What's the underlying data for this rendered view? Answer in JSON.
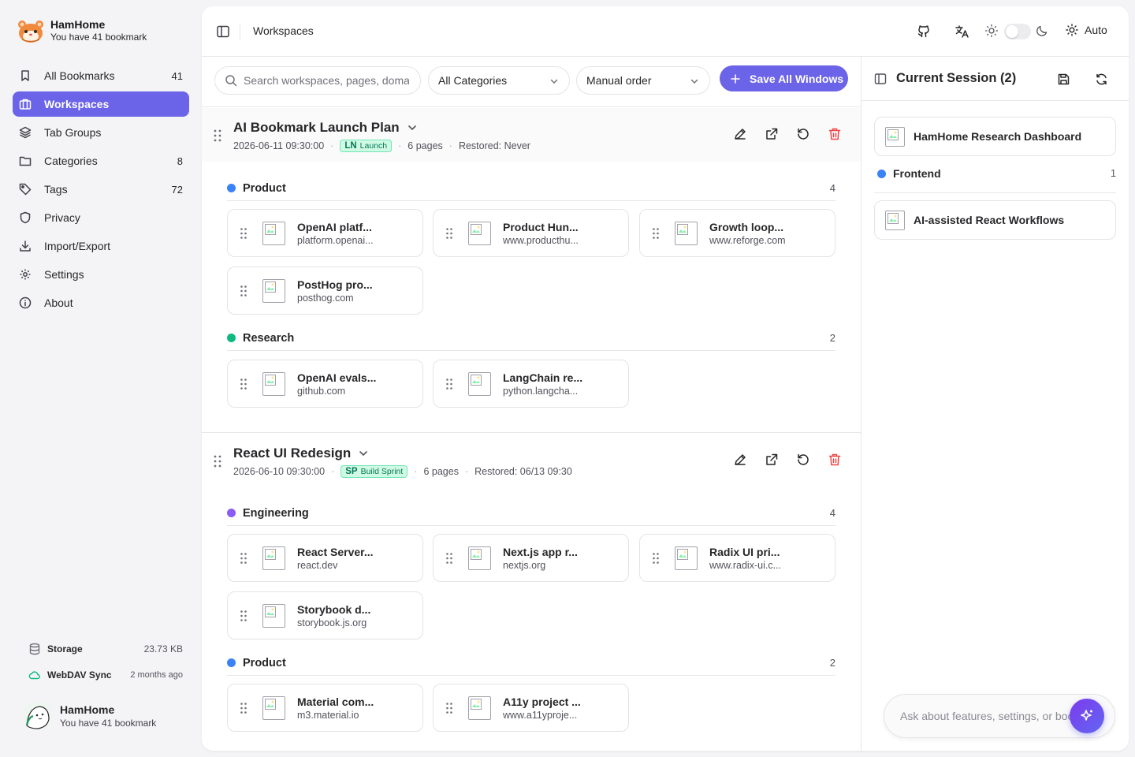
{
  "app": {
    "name": "HamHome",
    "subtitle": "You have 41 bookmark"
  },
  "nav": [
    {
      "label": "All Bookmarks",
      "count": "41",
      "icon": "bookmark-icon"
    },
    {
      "label": "Workspaces",
      "count": "",
      "icon": "briefcase-icon",
      "active": true
    },
    {
      "label": "Tab Groups",
      "count": "",
      "icon": "layers-icon"
    },
    {
      "label": "Categories",
      "count": "8",
      "icon": "folder-icon"
    },
    {
      "label": "Tags",
      "count": "72",
      "icon": "tag-icon"
    },
    {
      "label": "Privacy",
      "count": "",
      "icon": "shield-icon"
    },
    {
      "label": "Import/Export",
      "count": "",
      "icon": "download-icon"
    },
    {
      "label": "Settings",
      "count": "",
      "icon": "gear-icon"
    },
    {
      "label": "About",
      "count": "",
      "icon": "info-icon"
    }
  ],
  "storage": {
    "label": "Storage",
    "value": "23.73 KB",
    "sync_label": "WebDAV Sync",
    "sync_value": "2 months ago"
  },
  "user": {
    "name": "HamHome",
    "subtitle": "You have 41 bookmark"
  },
  "topbar": {
    "title": "Workspaces",
    "theme_mode": "Auto"
  },
  "filters": {
    "search_placeholder": "Search workspaces, pages, domains",
    "category": "All Categories",
    "order": "Manual order",
    "save_button": "Save All Windows"
  },
  "workspaces": [
    {
      "title": "AI Bookmark Launch Plan",
      "date": "2026-06-11 09:30:00",
      "tag_abbr": "LN",
      "tag": "Launch",
      "pages": "6 pages",
      "restored": "Restored: Never",
      "groups": [
        {
          "name": "Product",
          "color": "#3b82f6",
          "count": "4",
          "items": [
            {
              "title": "OpenAI platf...",
              "domain": "platform.openai..."
            },
            {
              "title": "Product Hun...",
              "domain": "www.producthu..."
            },
            {
              "title": "Growth loop...",
              "domain": "www.reforge.com"
            },
            {
              "title": "PostHog pro...",
              "domain": "posthog.com"
            }
          ]
        },
        {
          "name": "Research",
          "color": "#10b981",
          "count": "2",
          "items": [
            {
              "title": "OpenAI evals...",
              "domain": "github.com"
            },
            {
              "title": "LangChain re...",
              "domain": "python.langcha..."
            }
          ]
        }
      ]
    },
    {
      "title": "React UI Redesign",
      "date": "2026-06-10 09:30:00",
      "tag_abbr": "SP",
      "tag": "Build Sprint",
      "pages": "6 pages",
      "restored": "Restored: 06/13 09:30",
      "groups": [
        {
          "name": "Engineering",
          "color": "#8b5cf6",
          "count": "4",
          "items": [
            {
              "title": "React Server...",
              "domain": "react.dev"
            },
            {
              "title": "Next.js app r...",
              "domain": "nextjs.org"
            },
            {
              "title": "Radix UI pri...",
              "domain": "www.radix-ui.c..."
            },
            {
              "title": "Storybook d...",
              "domain": "storybook.js.org"
            }
          ]
        },
        {
          "name": "Product",
          "color": "#3b82f6",
          "count": "2",
          "items": [
            {
              "title": "Material com...",
              "domain": "m3.material.io"
            },
            {
              "title": "A11y project ...",
              "domain": "www.a11yproje..."
            }
          ]
        }
      ]
    }
  ],
  "session": {
    "title": "Current Session (2)",
    "items": [
      {
        "title": "HamHome Research Dashboard"
      }
    ],
    "group": {
      "name": "Frontend",
      "count": "1",
      "color": "#3b82f6",
      "items": [
        {
          "title": "AI-assisted React Workflows"
        }
      ]
    }
  },
  "assistant": {
    "placeholder": "Ask about features, settings, or bookmarks"
  },
  "colors": {
    "accent": "#6b63e8",
    "danger": "#ef4444",
    "tag_bg": "#d1fae5",
    "tag_text": "#047857"
  }
}
